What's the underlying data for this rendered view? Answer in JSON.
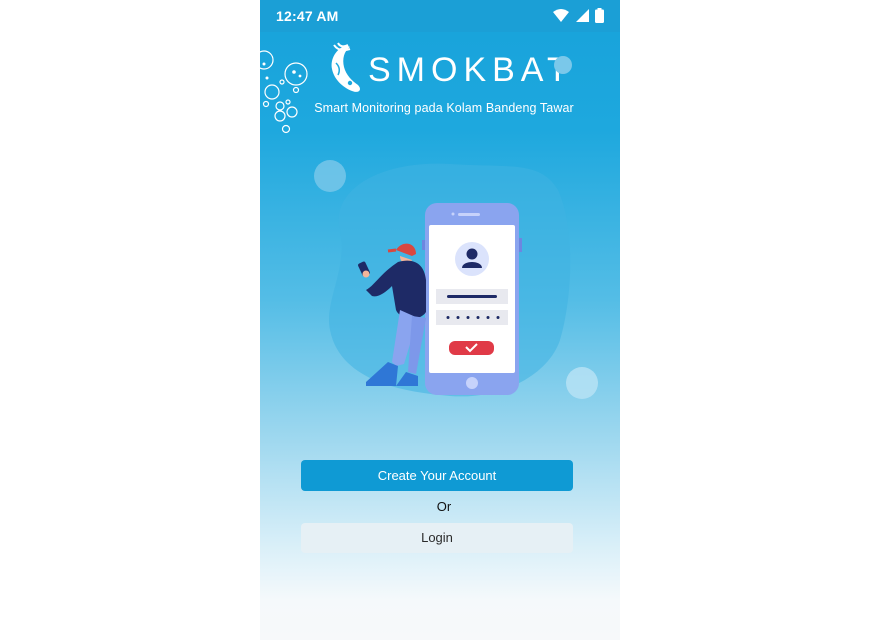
{
  "status_bar": {
    "time": "12:47 AM",
    "icons": [
      "wifi-icon",
      "signal-icon",
      "battery-icon"
    ]
  },
  "header": {
    "app_name": "SMOKBAT",
    "tagline": "Smart Monitoring pada Kolam Bandeng Tawar",
    "logo_icon": "fish-logo-icon"
  },
  "hero": {
    "illustration": "person-login-phone-illustration"
  },
  "actions": {
    "create_account_label": "Create Your Account",
    "or_label": "Or",
    "login_label": "Login"
  },
  "colors": {
    "primary": "#0f9ad4",
    "status_bar": "#1b9fd6",
    "login_button_bg": "#e6f0f5"
  }
}
